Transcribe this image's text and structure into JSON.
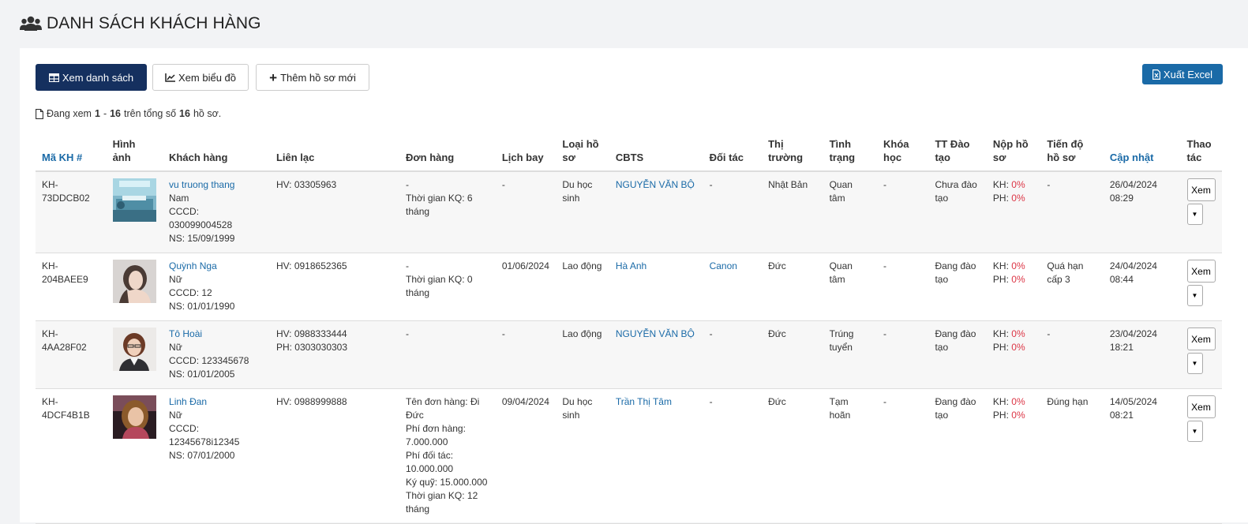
{
  "page": {
    "title": "DANH SÁCH KHÁCH HÀNG"
  },
  "toolbar": {
    "view_list": "Xem danh sách",
    "view_chart": "Xem biểu đồ",
    "add_new": "Thêm hồ sơ mới",
    "export_excel": "Xuất Excel"
  },
  "summary": {
    "prefix": "Đang xem",
    "from": "1",
    "sep": "-",
    "to": "16",
    "mid": "trên tổng số",
    "total": "16",
    "suffix": "hồ sơ."
  },
  "table": {
    "headers": [
      "Mã KH #",
      "Hình ảnh",
      "Khách hàng",
      "Liên lạc",
      "Đơn hàng",
      "Lịch bay",
      "Loại hồ sơ",
      "CBTS",
      "Đối tác",
      "Thị trường",
      "Tình trạng",
      "Khóa học",
      "TT Đào tạo",
      "Nộp hồ sơ",
      "Tiến độ hồ sơ",
      "Cập nhật",
      "Thao tác"
    ],
    "rows": [
      {
        "code": "KH-73DDCB02",
        "name": "vu truong thang",
        "gender": "Nam",
        "cccd": "CCCD: 030099004528",
        "dob": "NS: 15/09/1999",
        "contact1": "HV: 03305963",
        "contact2": "",
        "order": "-\nThời gian KQ: 6 tháng",
        "flight": "-",
        "type": "Du học sinh",
        "cbts": "NGUYỄN VĂN BỘ",
        "partner": "-",
        "market": "Nhật Bản",
        "status": "Quan tâm",
        "course": "-",
        "training": "Chưa đào tạo",
        "kh_label": "KH:",
        "kh": "0%",
        "ph_label": "PH:",
        "ph": "0%",
        "progress": "-",
        "updated": "26/04/2024 08:29",
        "action": "Xem",
        "photo": "lab"
      },
      {
        "code": "KH-204BAEE9",
        "name": "Quỳnh Nga",
        "gender": "Nữ",
        "cccd": "CCCD: 12",
        "dob": "NS: 01/01/1990",
        "contact1": "HV: 0918652365",
        "contact2": "",
        "order": "-\nThời gian KQ: 0 tháng",
        "flight": "01/06/2024",
        "type": "Lao động",
        "cbts": "Hà Anh",
        "partner": "Canon",
        "market": "Đức",
        "status": "Quan tâm",
        "course": "-",
        "training": "Đang đào tạo",
        "kh_label": "KH:",
        "kh": "0%",
        "ph_label": "PH:",
        "ph": "0%",
        "progress": "Quá hạn cấp 3",
        "updated": "24/04/2024 08:44",
        "action": "Xem",
        "photo": "woman-light"
      },
      {
        "code": "KH-4AA28F02",
        "name": "Tô Hoài",
        "gender": "Nữ",
        "cccd": "CCCD: 123345678",
        "dob": "NS: 01/01/2005",
        "contact1": "HV: 0988333444",
        "contact2": "PH: 0303030303",
        "order": "-",
        "flight": "-",
        "type": "Lao động",
        "cbts": "NGUYỄN VĂN BỘ",
        "partner": "-",
        "market": "Đức",
        "status": "Trúng tuyển",
        "course": "-",
        "training": "Đang đào tạo",
        "kh_label": "KH:",
        "kh": "0%",
        "ph_label": "PH:",
        "ph": "0%",
        "progress": "-",
        "updated": "23/04/2024 18:21",
        "action": "Xem",
        "photo": "woman-glasses"
      },
      {
        "code": "KH-4DCF4B1B",
        "name": "Linh Đan",
        "gender": "Nữ",
        "cccd": "CCCD: 12345678i12345",
        "dob": "NS: 07/01/2000",
        "contact1": "HV: 0988999888",
        "contact2": "",
        "order": "Tên đơn hàng: Đi Đức\nPhí đơn hàng: 7.000.000\nPhí đối tác: 10.000.000\nKý quỹ: 15.000.000\nThời gian KQ: 12 tháng",
        "flight": "09/04/2024",
        "type": "Du học sinh",
        "cbts": "Trần Thị Tâm",
        "partner": "-",
        "market": "Đức",
        "status": "Tạm hoãn",
        "course": "-",
        "training": "Đang đào tạo",
        "kh_label": "KH:",
        "kh": "0%",
        "ph_label": "PH:",
        "ph": "0%",
        "progress": "Đúng hạn",
        "updated": "14/05/2024 08:21",
        "action": "Xem",
        "photo": "woman-dark"
      }
    ]
  },
  "colors": {
    "primary": "#15305f",
    "link": "#1a6aa7",
    "excel": "#1a6aa7",
    "danger": "#dc3545"
  },
  "icons": {
    "title": "users-icon",
    "list": "table-icon",
    "chart": "line-chart-icon",
    "add": "plus-icon",
    "excel": "file-excel-icon",
    "summary": "file-icon",
    "dropdown": "caret-down-icon"
  }
}
